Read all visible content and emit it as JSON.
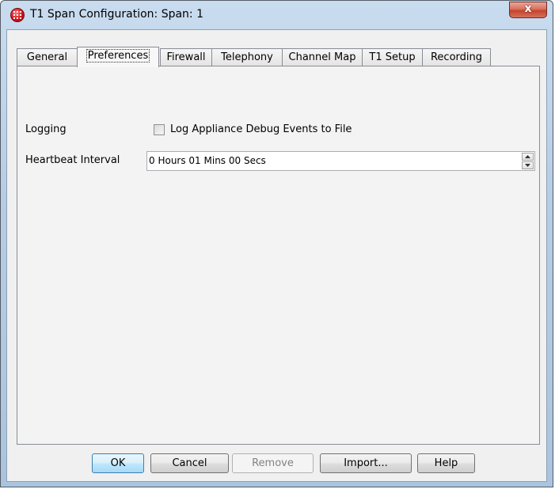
{
  "window": {
    "title": "T1 Span Configuration: Span: 1",
    "close_label": "x"
  },
  "tabs": [
    {
      "label": "General",
      "active": false
    },
    {
      "label": "Preferences",
      "active": true
    },
    {
      "label": "Firewall",
      "active": false
    },
    {
      "label": "Telephony",
      "active": false
    },
    {
      "label": "Channel Map",
      "active": false
    },
    {
      "label": "T1 Setup",
      "active": false
    },
    {
      "label": "Recording",
      "active": false
    }
  ],
  "preferences": {
    "logging_label": "Logging",
    "log_debug_checkbox_label": "Log Appliance Debug Events to File",
    "log_debug_checked": false,
    "heartbeat_label": "Heartbeat Interval",
    "heartbeat_value": "0 Hours 01 Mins 00 Secs"
  },
  "buttons": {
    "ok": "OK",
    "cancel": "Cancel",
    "remove": "Remove",
    "import": "Import...",
    "help": "Help"
  },
  "colors": {
    "title_bar": "#b7cde5",
    "panel_bg": "#f0f0f0",
    "close_button": "#c4432d",
    "default_button_border": "#3c7fb1"
  },
  "icons": {
    "app": "telephony-grid-icon",
    "close": "close-icon",
    "spinner_up": "spinner-up-icon",
    "spinner_down": "spinner-down-icon"
  }
}
